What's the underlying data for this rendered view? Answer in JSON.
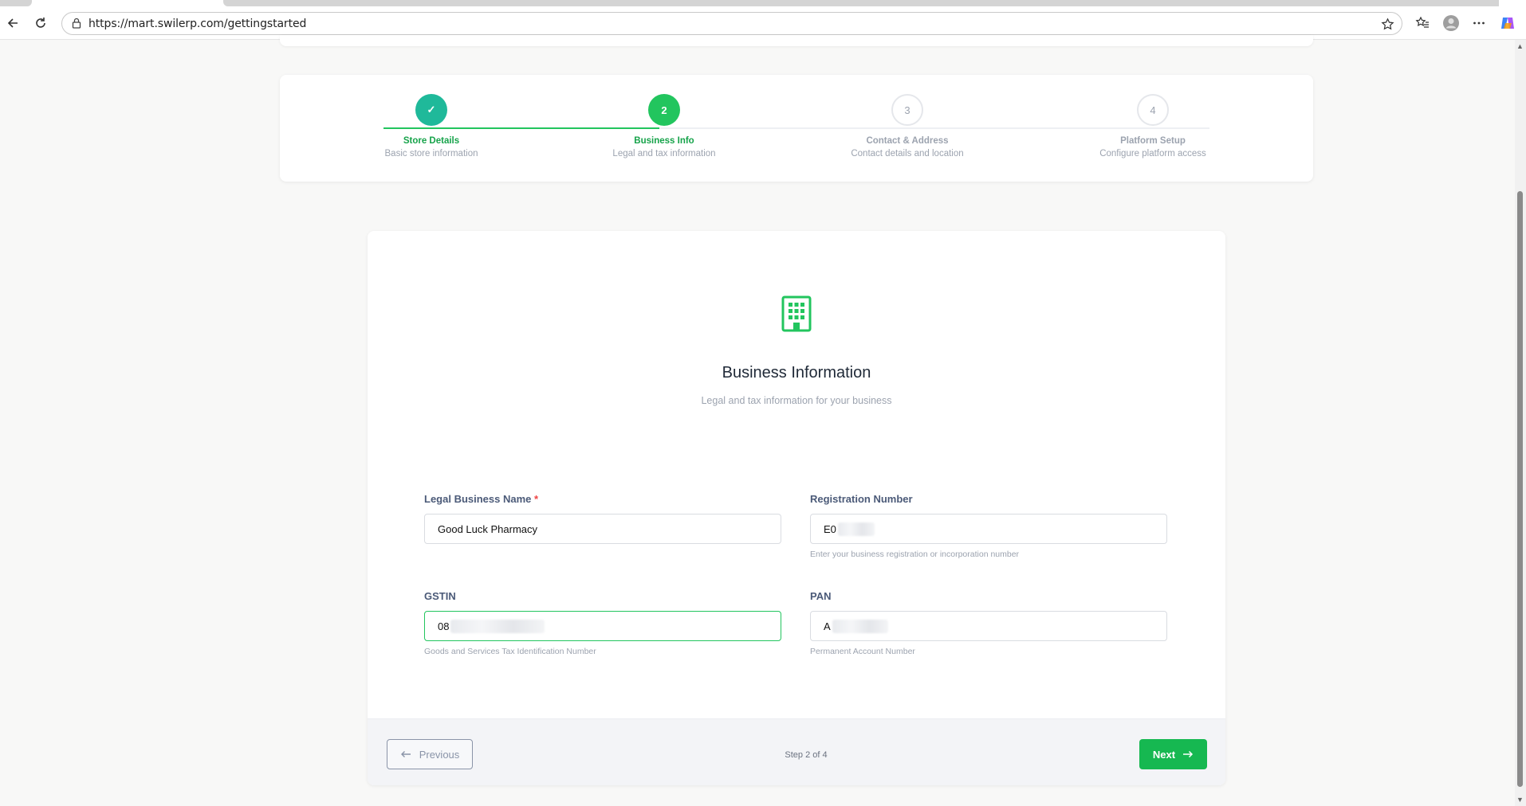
{
  "browser": {
    "url": "https://mart.swilerp.com/gettingstarted"
  },
  "stepper": {
    "steps": [
      {
        "number": "✓",
        "title": "Store Details",
        "description": "Basic store information",
        "state": "done"
      },
      {
        "number": "2",
        "title": "Business Info",
        "description": "Legal and tax information",
        "state": "active"
      },
      {
        "number": "3",
        "title": "Contact & Address",
        "description": "Contact details and location",
        "state": "todo"
      },
      {
        "number": "4",
        "title": "Platform Setup",
        "description": "Configure platform access",
        "state": "todo"
      }
    ]
  },
  "form": {
    "icon": "building-icon",
    "title": "Business Information",
    "subtitle": "Legal and tax information for your business",
    "legal_name": {
      "label": "Legal Business Name",
      "required_mark": "*",
      "value": "Good Luck Pharmacy"
    },
    "registration": {
      "label": "Registration Number",
      "value": "E0",
      "help": "Enter your business registration or incorporation number"
    },
    "gstin": {
      "label": "GSTIN",
      "value": "08",
      "help": "Goods and Services Tax Identification Number"
    },
    "pan": {
      "label": "PAN",
      "value": "A",
      "help": "Permanent Account Number"
    }
  },
  "footer": {
    "previous_label": "Previous",
    "step_text": "Step 2 of 4",
    "next_label": "Next"
  },
  "colors": {
    "accent": "#22c55e",
    "done": "#1fb99a",
    "muted": "#9ca3af"
  }
}
